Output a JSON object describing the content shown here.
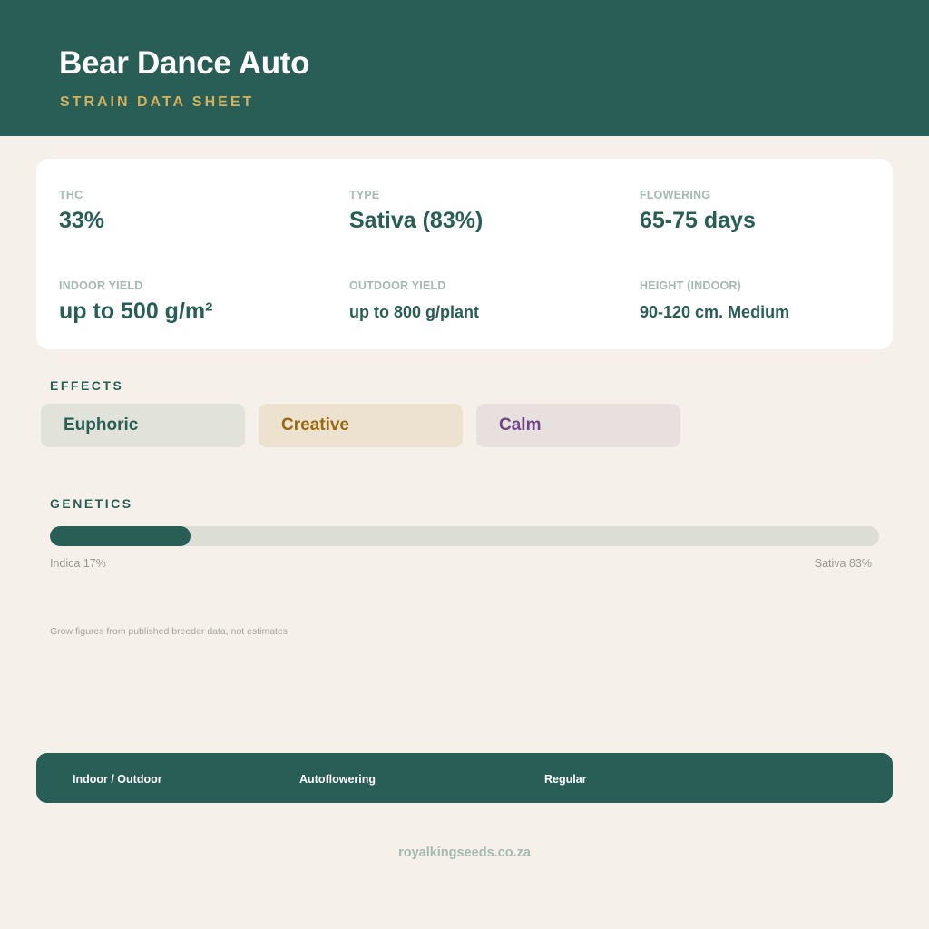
{
  "header": {
    "title": "Bear Dance Auto",
    "subtitle": "STRAIN DATA SHEET"
  },
  "stats": [
    {
      "label": "THC",
      "value": "33%"
    },
    {
      "label": "TYPE",
      "value": "Sativa (83%)"
    },
    {
      "label": "FLOWERING",
      "value": "65-75 days"
    },
    {
      "label": "INDOOR YIELD",
      "value": "up to 500 g/m²"
    },
    {
      "label": "OUTDOOR YIELD",
      "value": "up to 800 g/plant"
    },
    {
      "label": "HEIGHT (INDOOR)",
      "value": "90-120 cm. Medium"
    }
  ],
  "effects": {
    "heading": "EFFECTS",
    "items": [
      "Euphoric",
      "Creative",
      "Calm"
    ]
  },
  "genetics": {
    "heading": "GENETICS",
    "indica_percent": 17,
    "sativa_percent": 83,
    "indica_label": "Indica 17%",
    "sativa_label": "Sativa 83%"
  },
  "note": "Grow figures from published breeder data, not estimates",
  "footer": {
    "items": [
      "Indoor / Outdoor",
      "Autoflowering",
      "Regular"
    ]
  },
  "site": "royalkingseeds.co.za",
  "colors": {
    "primary": "#285e56",
    "accent": "#d2b25e",
    "background": "#f5f0ea"
  }
}
